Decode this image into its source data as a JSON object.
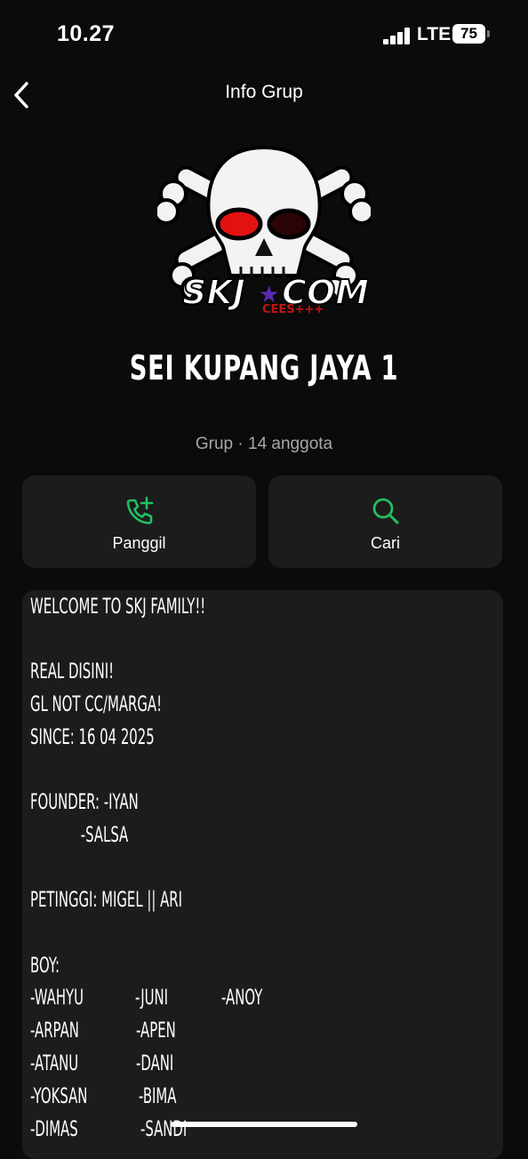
{
  "status_bar": {
    "time": "10.27",
    "network": "LTE",
    "battery": "75"
  },
  "nav": {
    "title": "Info Grup",
    "back_icon": "chevron-left-icon"
  },
  "group": {
    "avatar_text_main": "SKJ",
    "avatar_text_com": "COM",
    "avatar_text_sub": "CEES+++",
    "name": "SEI KUPANG JAYA 1",
    "type": "Grup",
    "separator": "·",
    "members": "14 anggota"
  },
  "actions": [
    {
      "label": "Panggil",
      "icon": "phone-add-icon"
    },
    {
      "label": "Cari",
      "icon": "search-icon"
    }
  ],
  "colors": {
    "accent_green": "#21c063",
    "card_bg": "#1c1c1c",
    "background": "#0b0b0b"
  },
  "description": {
    "line1": "WELCOME TO SKJ FAMILY!!",
    "line2": "REAL DISINI!",
    "line3": "GL NOT CC/MARGA!",
    "line4": "SINCE: 16 04 2025",
    "line5": "FOUNDER: -IYAN",
    "line6": "            -SALSA",
    "line7": "PETINGGI: MIGEL || ARI",
    "line8": "BOY:",
    "boys_col1": [
      "-WAHYU",
      "-ARPAN",
      "-ATANU",
      "-YOKSAN",
      "-DIMAS"
    ],
    "boys_col2": [
      "-JUNI",
      "-APEN",
      "-DANI",
      "-BIMA",
      "-SANDI"
    ],
    "boys_col3": [
      "-ANOY"
    ]
  }
}
